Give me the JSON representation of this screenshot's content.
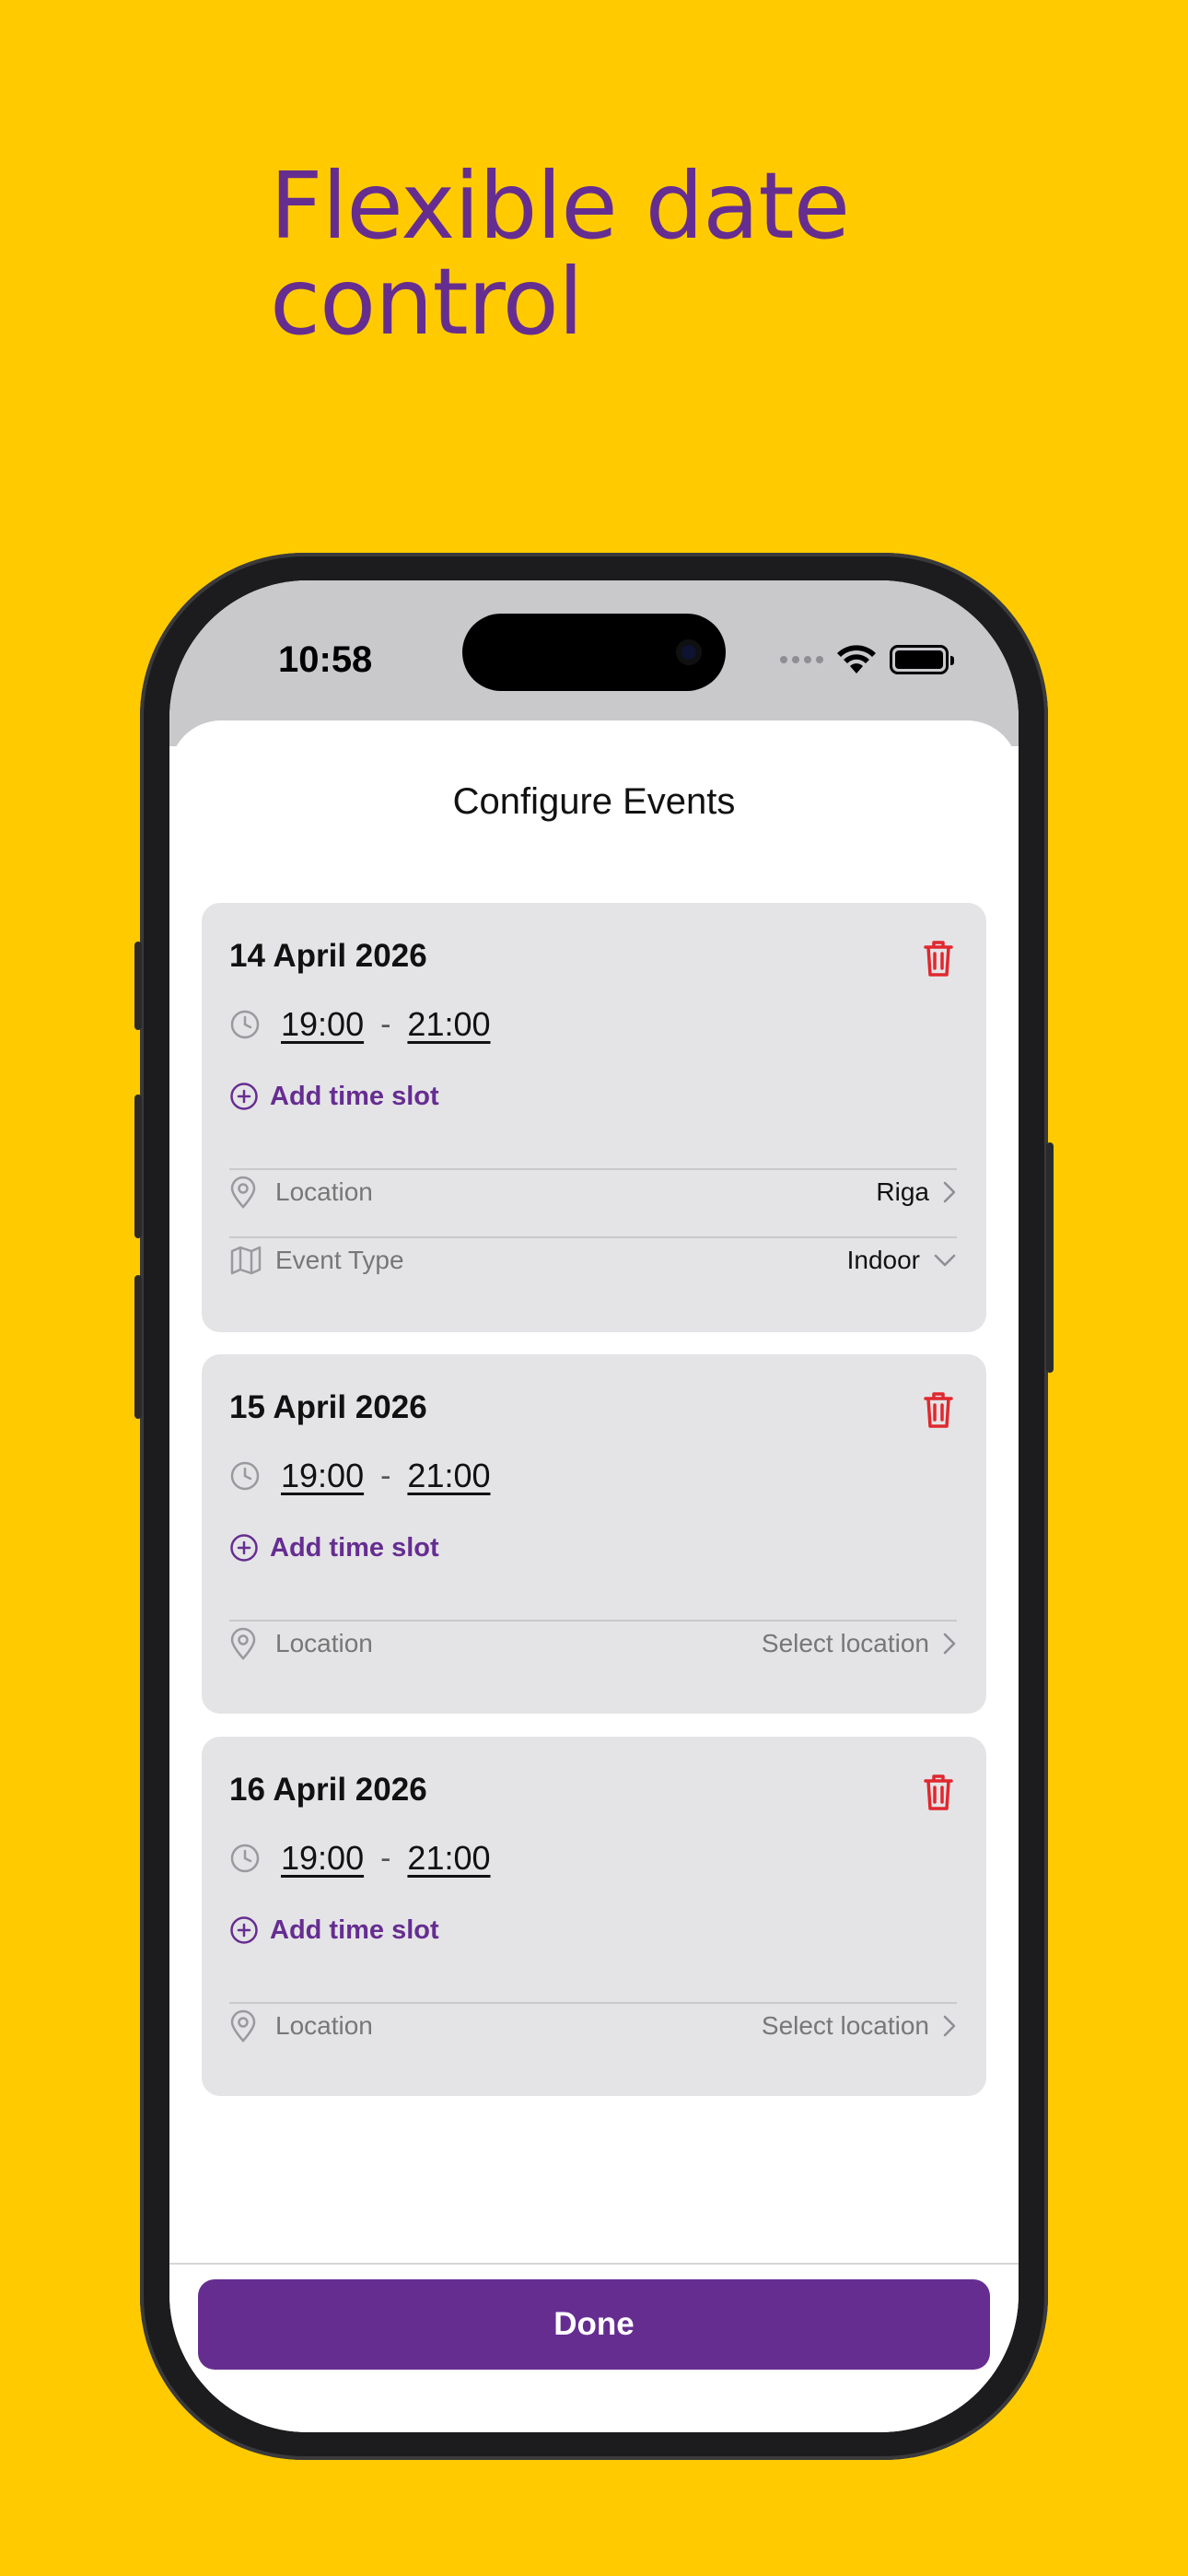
{
  "headline": {
    "line1": "Flexible date",
    "line2": "control"
  },
  "status_bar": {
    "time": "10:58"
  },
  "sheet": {
    "title": "Configure Events"
  },
  "events": [
    {
      "date": "14 April 2026",
      "start": "19:00",
      "separator": "-",
      "end": "21:00",
      "add_slot": "Add time slot",
      "location_label": "Location",
      "location_value": "Riga",
      "event_type_label": "Event Type",
      "event_type_value": "Indoor"
    },
    {
      "date": "15 April 2026",
      "start": "19:00",
      "separator": "-",
      "end": "21:00",
      "add_slot": "Add time slot",
      "location_label": "Location",
      "location_value": "Select location"
    },
    {
      "date": "16 April 2026",
      "start": "19:00",
      "separator": "-",
      "end": "21:00",
      "add_slot": "Add time slot",
      "location_label": "Location",
      "location_value": "Select location"
    }
  ],
  "footer": {
    "done_label": "Done"
  },
  "colors": {
    "background": "#FFCB00",
    "accent": "#662D91",
    "delete": "#E0282E",
    "card": "#E4E4E6"
  },
  "icons": [
    "clock-icon",
    "plus-circle-icon",
    "location-pin-icon",
    "map-icon",
    "chevron-right-icon",
    "chevron-down-icon",
    "trash-icon",
    "wifi-icon",
    "battery-icon"
  ]
}
